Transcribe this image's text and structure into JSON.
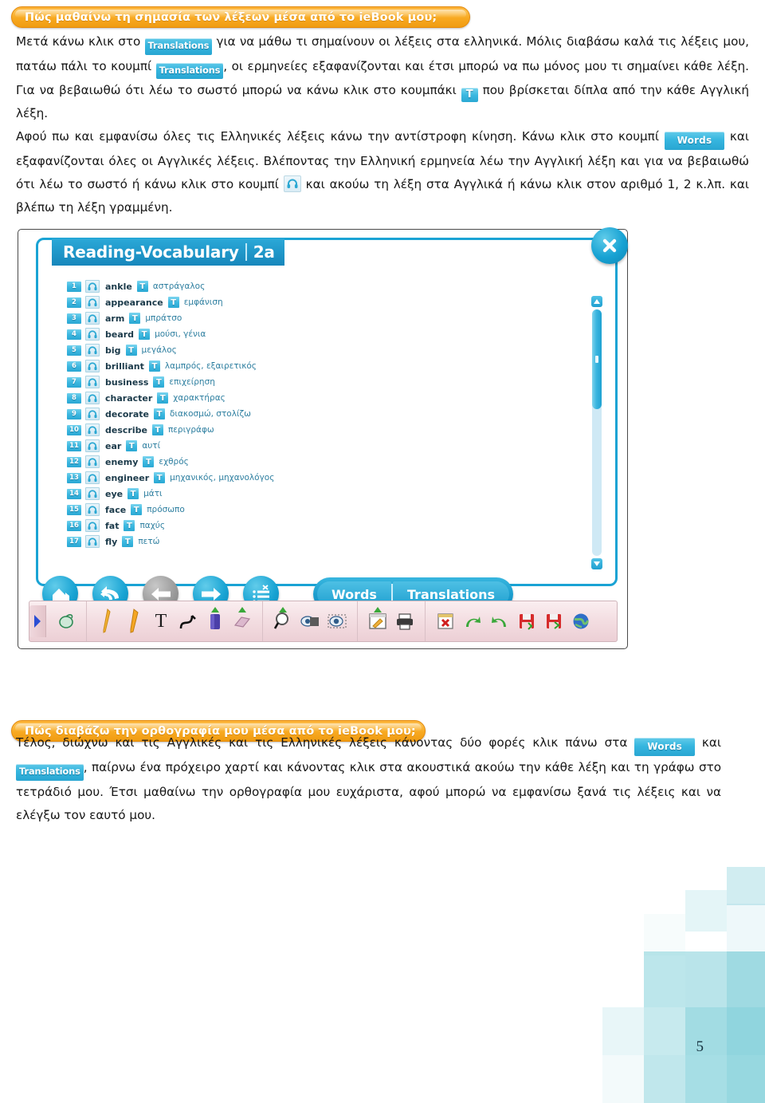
{
  "section1": {
    "banner": "Πώς μαθαίνω τη σημασία των λέξεων μέσα από το ieBook μου;",
    "p1_a": "Μετά κάνω κλικ στο ",
    "badge_translations_1": "Translations",
    "p1_b": " για να μάθω τι σημαίνουν οι λέξεις στα ελληνικά. Μόλις διαβάσω καλά τις λέξεις μου, πατάω πάλι το κουμπί ",
    "badge_translations_2": "Translations",
    "p1_c": ", οι ερμηνείες εξαφανίζονται και έτσι μπορώ να πω μόνος μου τι σημαίνει κάθε λέξη. Για να βεβαιωθώ ότι λέω το σωστό μπορώ να κάνω κλικ στο κουμπάκι ",
    "badge_t": "T",
    "p1_d": " που βρίσκεται δίπλα από την κάθε Αγγλική λέξη.",
    "p1_e": "Αφού πω και εμφανίσω όλες τις Ελληνικές λέξεις κάνω την αντίστροφη κίνηση. Κάνω κλικ στο κουμπί ",
    "badge_words_1": "Words",
    "p1_f": " και εξαφανίζονται όλες οι Αγγλικές λέξεις. Βλέποντας την Ελληνική ερμηνεία λέω την Αγγλική λέξη και για να βεβαιωθώ ότι λέω το σωστό ή κάνω κλικ στο κουμπί ",
    "p1_g": " και ακούω τη λέξη στα Αγγλικά ή κάνω κλικ στον αριθμό 1, 2 κ.λπ. και βλέπω τη λέξη γραμμένη."
  },
  "app": {
    "title": "Reading-Vocabulary",
    "unit": "2a",
    "close_label": "✖",
    "words": [
      {
        "n": "1",
        "en": "ankle",
        "gr": "αστράγαλος"
      },
      {
        "n": "2",
        "en": "appearance",
        "gr": "εμφάνιση"
      },
      {
        "n": "3",
        "en": "arm",
        "gr": "μπράτσο"
      },
      {
        "n": "4",
        "en": "beard",
        "gr": "μούσι, γένια"
      },
      {
        "n": "5",
        "en": "big",
        "gr": "μεγάλος"
      },
      {
        "n": "6",
        "en": "brilliant",
        "gr": "λαμπρός, εξαιρετικός"
      },
      {
        "n": "7",
        "en": "business",
        "gr": "επιχείρηση"
      },
      {
        "n": "8",
        "en": "character",
        "gr": "χαρακτήρας"
      },
      {
        "n": "9",
        "en": "decorate",
        "gr": "διακοσμώ, στολίζω"
      },
      {
        "n": "10",
        "en": "describe",
        "gr": "περιγράφω"
      },
      {
        "n": "11",
        "en": "ear",
        "gr": "αυτί"
      },
      {
        "n": "12",
        "en": "enemy",
        "gr": "εχθρός"
      },
      {
        "n": "13",
        "en": "engineer",
        "gr": "μηχανικός, μηχανολόγος"
      },
      {
        "n": "14",
        "en": "eye",
        "gr": "μάτι"
      },
      {
        "n": "15",
        "en": "face",
        "gr": "πρόσωπο"
      },
      {
        "n": "16",
        "en": "fat",
        "gr": "παχύς"
      },
      {
        "n": "17",
        "en": "fly",
        "gr": "πετώ"
      }
    ],
    "t_letter": "T",
    "tabs": {
      "words": "Words",
      "translations": "Translations"
    },
    "nav_icons": [
      "home-icon",
      "undo-arrow-icon",
      "back-arrow-icon",
      "forward-arrow-icon",
      "list-icon"
    ],
    "tools": [
      "mouse-pointer-icon",
      "thin-pen-icon",
      "pencil-icon",
      "text-tool-icon",
      "curve-tool-icon",
      "highlighter-icon",
      "eraser-icon",
      "magnifier-icon",
      "reveal-icon",
      "spotlight-icon",
      "notes-icon",
      "print-icon",
      "close-window-icon",
      "undo-icon",
      "redo-icon",
      "save-icon",
      "save-as-icon",
      "globe-icon"
    ],
    "accent_color": "#1aa3d4",
    "title_bar_color": "#1f96c8"
  },
  "section2": {
    "banner": "Πώς διαβάζω την ορθογραφία μου μέσα από το ieBook μου;",
    "p2_a": "Τέλος, διώχνω και τις Αγγλικές και τις Ελληνικές λέξεις κάνοντας δύο φορές κλικ πάνω στα ",
    "badge_words": "Words",
    "p2_b": " και ",
    "badge_translations": "Translations",
    "p2_c": ", παίρνω ένα πρόχειρο χαρτί και κάνοντας κλικ στα ακουστικά ακούω την κάθε λέξη και τη γράφω στο τετράδιό μου. Έτσι μαθαίνω την ορθογραφία μου ευχάριστα, αφού μπορώ να εμφανίσω ξανά τις λέξεις και να ελέγξω τον εαυτό μου."
  },
  "footer": {
    "page_number": "5"
  },
  "colors": {
    "banner_orange": "#f8a921",
    "badge_blue": "#34b5de",
    "mosaic_teal": "#79cdd6"
  }
}
